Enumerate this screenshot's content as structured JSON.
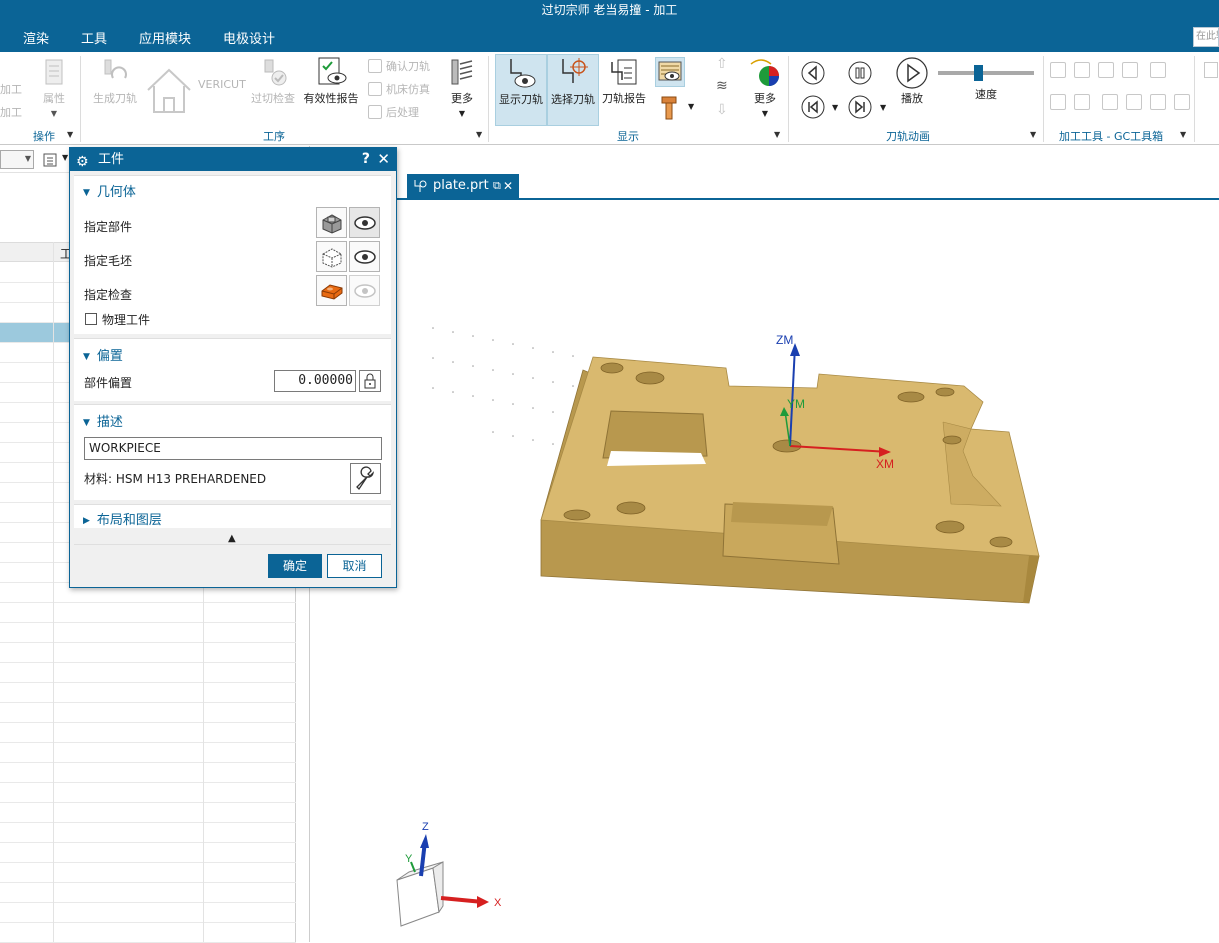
{
  "window": {
    "title": "过切宗师  老当易撞 - 加工"
  },
  "menubar": {
    "items": [
      "渲染",
      "工具",
      "应用模块",
      "电极设计"
    ],
    "search_placeholder": "在此输"
  },
  "ribbon": {
    "ops_group": {
      "partial_items": [
        "加工",
        "加工"
      ],
      "attributes": "属性",
      "label": "操作"
    },
    "process_group": {
      "generate_path": "生成刀轨",
      "vericut": "VERICUT",
      "gouge_check": "过切检查",
      "validity_report": "有效性报告",
      "confirm_path": "确认刀轨",
      "machine_sim": "机床仿真",
      "postprocess": "后处理",
      "more": "更多",
      "label": "工序"
    },
    "display_group": {
      "show_path": "显示刀轨",
      "select_path": "选择刀轨",
      "path_report": "刀轨报告",
      "more": "更多",
      "label": "显示"
    },
    "animation_group": {
      "play": "播放",
      "speed": "速度",
      "speed_level": 0.42,
      "label": "刀轨动画"
    },
    "tools_group": {
      "label": "加工工具 - GC工具箱"
    }
  },
  "left_pane": {
    "column_header": "工"
  },
  "viewport": {
    "tab_label": "plate.prt"
  },
  "axes": {
    "zm": "ZM",
    "ym": "YM",
    "xm": "XM",
    "z": "Z",
    "y": "Y",
    "x": "X"
  },
  "colors": {
    "accent": "#0b6496",
    "part": "#d9b96f",
    "selected_row": "#9cc9dd",
    "x_axis": "#d62020",
    "y_axis": "#1e9b3a",
    "z_axis": "#1a3fb0"
  },
  "dialog": {
    "title": "工件",
    "help_icon": "?",
    "close_icon": "✕",
    "geometry": {
      "header": "几何体",
      "specify_part": "指定部件",
      "specify_blank": "指定毛坯",
      "specify_check": "指定检查",
      "physical_workpiece": "物理工件",
      "physical_workpiece_checked": false
    },
    "offset": {
      "header": "偏置",
      "part_offset_label": "部件偏置",
      "part_offset_value": "0.00000"
    },
    "description": {
      "header": "描述",
      "text": "WORKPIECE",
      "material": "材料: HSM H13 PREHARDENED"
    },
    "layout": {
      "header": "布局和图层"
    },
    "ok": "确定",
    "cancel": "取消"
  }
}
